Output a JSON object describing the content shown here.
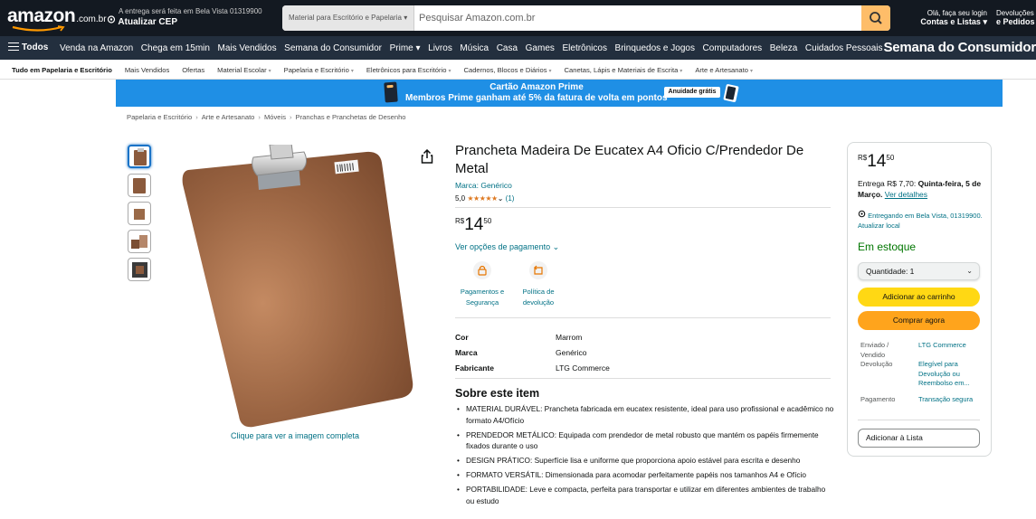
{
  "header": {
    "logo_text": "amazon",
    "logo_tld": ".com.br",
    "deliver_line1": "A entrega será feita em Bela Vista 01319900",
    "deliver_line2": "Atualizar CEP",
    "search_category": "Material para Escritório e Papelaria",
    "search_placeholder": "Pesquisar Amazon.com.br",
    "account_line1": "Olá, faça seu login",
    "account_line2": "Contas e Listas",
    "returns_line1": "Devoluções",
    "returns_line2": "e Pedidos"
  },
  "main_nav": {
    "all_label": "Todos",
    "items": [
      "Venda na Amazon",
      "Chega em 15min",
      "Mais Vendidos",
      "Semana do Consumidor",
      "Prime",
      "Livros",
      "Música",
      "Casa",
      "Games",
      "Eletrônicos",
      "Brinquedos e Jogos",
      "Computadores",
      "Beleza",
      "Cuidados Pessoais"
    ],
    "promo": "Semana do Consumidor"
  },
  "sub_nav": {
    "items": [
      "Tudo em Papelaria e Escritório",
      "Mais Vendidos",
      "Ofertas",
      "Material Escolar",
      "Papelaria e Escritório",
      "Eletrônicos para Escritório",
      "Cadernos, Blocos e Diários",
      "Canetas, Lápis e Materiais de Escrita",
      "Arte e Artesanato"
    ]
  },
  "banner": {
    "line1": "Cartão Amazon Prime",
    "line2": "Membros Prime ganham até 5% da fatura de volta em pontos",
    "pill": "Anuidade grátis"
  },
  "breadcrumb": [
    "Papelaria e Escritório",
    "Arte e Artesanato",
    "Móveis",
    "Pranchas e Pranchetas de Desenho"
  ],
  "gallery": {
    "link": "Clique para ver a imagem completa"
  },
  "product": {
    "title": "Prancheta Madeira De Eucatex A4 Oficio C/Prendedor De Metal",
    "brand_link": "Marca: Genérico",
    "rating": "5,0",
    "stars": "★★★★★",
    "rating_count": "(1)",
    "price_currency": "R$",
    "price_whole": "14",
    "price_fraction": "50",
    "payment_options": "Ver opções de pagamento",
    "features": [
      {
        "line1": "Pagamentos e",
        "line2": "Segurança"
      },
      {
        "line1": "Política de",
        "line2": "devolução"
      }
    ],
    "specs": [
      {
        "key": "Cor",
        "value": "Marrom"
      },
      {
        "key": "Marca",
        "value": "Genérico"
      },
      {
        "key": "Fabricante",
        "value": "LTG Commerce"
      }
    ],
    "about_title": "Sobre este item",
    "bullets": [
      "MATERIAL DURÁVEL: Prancheta fabricada em eucatex resistente, ideal para uso profissional e acadêmico no formato A4/Ofício",
      "PRENDEDOR METÁLICO: Equipada com prendedor de metal robusto que mantém os papéis firmemente fixados durante o uso",
      "DESIGN PRÁTICO: Superfície lisa e uniforme que proporciona apoio estável para escrita e desenho",
      "FORMATO VERSÁTIL: Dimensionada para acomodar perfeitamente papéis nos tamanhos A4 e Ofício",
      "PORTABILIDADE: Leve e compacta, perfeita para transportar e utilizar em diferentes ambientes de trabalho ou estudo"
    ]
  },
  "buybox": {
    "price_currency": "R$",
    "price_whole": "14",
    "price_fraction": "50",
    "delivery_prefix": "Entrega R$ 7,70:",
    "delivery_date": "Quinta-feira, 5 de Março.",
    "delivery_link": "Ver detalhes",
    "location": "Entregando em Bela Vista, 01319900. Atualizar local",
    "stock": "Em estoque",
    "quantity": "Quantidade: 1",
    "add_to_cart": "Adicionar ao carrinho",
    "buy_now": "Comprar agora",
    "shipped_key": "Enviado / Vendido",
    "shipped_val": "LTG Commerce",
    "return_key": "Devolução",
    "return_val": "Elegível para Devolução ou Reembolso em...",
    "payment_key": "Pagamento",
    "payment_val": "Transação segura",
    "add_to_list": "Adicionar à Lista"
  },
  "colors": {
    "nav_dark": "#131921",
    "nav_secondary": "#232f3e",
    "search_button": "#febd69",
    "banner_blue": "#1f8fe5",
    "link": "#007185",
    "add_to_cart": "#ffd814",
    "buy_now": "#ffa41c",
    "in_stock": "#007600",
    "stars": "#de7921"
  }
}
